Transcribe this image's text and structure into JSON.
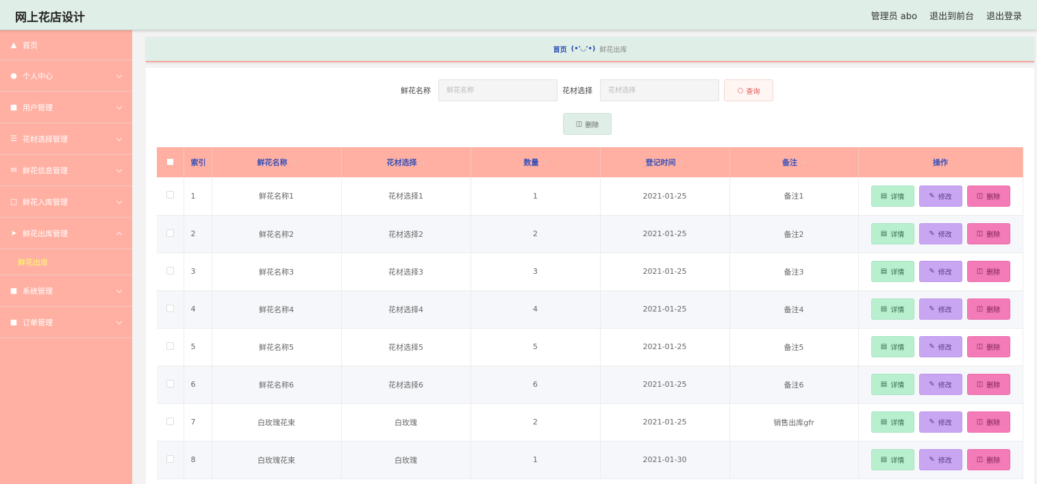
{
  "header": {
    "title": "网上花店设计",
    "admin_label": "管理员 abo",
    "front_link": "退出到前台",
    "logout_link": "退出登录"
  },
  "sidebar": {
    "items": [
      {
        "label": "首页",
        "icon": "home-icon"
      },
      {
        "label": "个人中心",
        "icon": "user-icon"
      },
      {
        "label": "用户管理",
        "icon": "clipboard-icon"
      },
      {
        "label": "花材选择管理",
        "icon": "list-icon"
      },
      {
        "label": "鲜花信息管理",
        "icon": "mail-icon"
      },
      {
        "label": "鲜花入库管理",
        "icon": "chat-icon"
      },
      {
        "label": "鲜花出库管理",
        "icon": "send-icon"
      },
      {
        "label": "系统管理",
        "icon": "clipboard-check-icon"
      },
      {
        "label": "订单管理",
        "icon": "doc-icon"
      }
    ],
    "sub_active": "鲜花出库"
  },
  "breadcrumb": {
    "home": "首页",
    "separator": "(•'◡'•)",
    "current": "鲜花出库"
  },
  "search": {
    "name_label": "鲜花名称",
    "name_placeholder": "鲜花名称",
    "material_label": "花材选择",
    "material_placeholder": "花材选择",
    "query_button": "查询",
    "delete_button": "删除"
  },
  "table": {
    "columns": [
      "索引",
      "鲜花名称",
      "花材选择",
      "数量",
      "登记时间",
      "备注",
      "操作"
    ],
    "actions": {
      "detail": "详情",
      "edit": "修改",
      "delete": "删除"
    },
    "rows": [
      {
        "idx": "1",
        "name": "鲜花名称1",
        "material": "花材选择1",
        "qty": "1",
        "date": "2021-01-25",
        "note": "备注1"
      },
      {
        "idx": "2",
        "name": "鲜花名称2",
        "material": "花材选择2",
        "qty": "2",
        "date": "2021-01-25",
        "note": "备注2"
      },
      {
        "idx": "3",
        "name": "鲜花名称3",
        "material": "花材选择3",
        "qty": "3",
        "date": "2021-01-25",
        "note": "备注3"
      },
      {
        "idx": "4",
        "name": "鲜花名称4",
        "material": "花材选择4",
        "qty": "4",
        "date": "2021-01-25",
        "note": "备注4"
      },
      {
        "idx": "5",
        "name": "鲜花名称5",
        "material": "花材选择5",
        "qty": "5",
        "date": "2021-01-25",
        "note": "备注5"
      },
      {
        "idx": "6",
        "name": "鲜花名称6",
        "material": "花材选择6",
        "qty": "6",
        "date": "2021-01-25",
        "note": "备注6"
      },
      {
        "idx": "7",
        "name": "白玫瑰花束",
        "material": "白玫瑰",
        "qty": "2",
        "date": "2021-01-25",
        "note": "销售出库gfr"
      },
      {
        "idx": "8",
        "name": "白玫瑰花束",
        "material": "白玫瑰",
        "qty": "1",
        "date": "2021-01-30",
        "note": ""
      }
    ]
  },
  "colors": {
    "header_bg": "#dfeee6",
    "sidebar_bg": "#ffb0a3",
    "table_head_bg": "#ffb0a3",
    "detail_btn": "#b7efcf",
    "edit_btn": "#c9a6f2",
    "delete_btn": "#f37bb7"
  }
}
